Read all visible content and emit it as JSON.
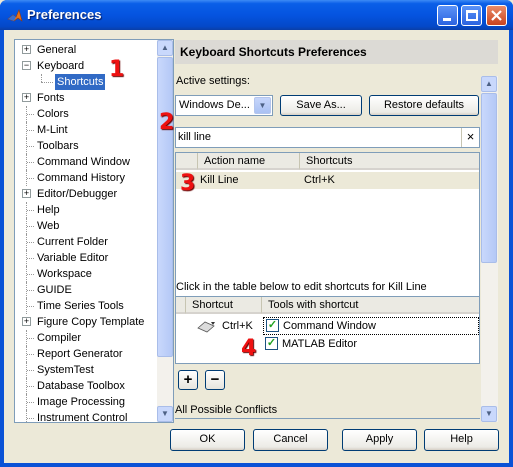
{
  "window": {
    "title": "Preferences",
    "icon": "matlab-logo-icon"
  },
  "tree": {
    "items": [
      {
        "label": "General",
        "expandable": true
      },
      {
        "label": "Keyboard",
        "expandable": true,
        "expanded": true
      },
      {
        "label": "Shortcuts",
        "selected": true,
        "child": true
      },
      {
        "label": "Fonts",
        "expandable": true
      },
      {
        "label": "Colors"
      },
      {
        "label": "M-Lint"
      },
      {
        "label": "Toolbars"
      },
      {
        "label": "Command Window"
      },
      {
        "label": "Command History"
      },
      {
        "label": "Editor/Debugger",
        "expandable": true
      },
      {
        "label": "Help"
      },
      {
        "label": "Web"
      },
      {
        "label": "Current Folder"
      },
      {
        "label": "Variable Editor"
      },
      {
        "label": "Workspace"
      },
      {
        "label": "GUIDE"
      },
      {
        "label": "Time Series Tools"
      },
      {
        "label": "Figure Copy Template",
        "expandable": true
      },
      {
        "label": "Compiler"
      },
      {
        "label": "Report Generator"
      },
      {
        "label": "SystemTest"
      },
      {
        "label": "Database Toolbox"
      },
      {
        "label": "Image Processing"
      },
      {
        "label": "Instrument Control"
      }
    ]
  },
  "panel": {
    "heading": "Keyboard Shortcuts Preferences",
    "active_settings_label": "Active settings:",
    "active_setting_value": "Windows De...",
    "save_as_label": "Save As...",
    "restore_label": "Restore defaults",
    "search_value": "kill line",
    "clear_glyph": "×",
    "actions_table": {
      "columns": [
        "Action name",
        "Shortcuts"
      ],
      "rows": [
        {
          "action": "Kill Line",
          "shortcut": "Ctrl+K"
        }
      ]
    },
    "edit_hint": "Click in the table below to edit shortcuts for Kill Line",
    "tools_table": {
      "columns": [
        "Shortcut",
        "Tools with shortcut"
      ],
      "shortcut": "Ctrl+K",
      "tools": [
        {
          "label": "Command Window",
          "checked": true
        },
        {
          "label": "MATLAB Editor",
          "checked": true
        }
      ]
    },
    "add_label": "+",
    "remove_label": "−",
    "conflicts_label": "All Possible Conflicts"
  },
  "annotations": [
    "1",
    "2",
    "3",
    "4"
  ],
  "footer": {
    "ok": "OK",
    "cancel": "Cancel",
    "apply": "Apply",
    "help": "Help"
  },
  "colors": {
    "titlebar": "#0554e0",
    "selection": "#316ac5",
    "annotation": "#e11111"
  }
}
